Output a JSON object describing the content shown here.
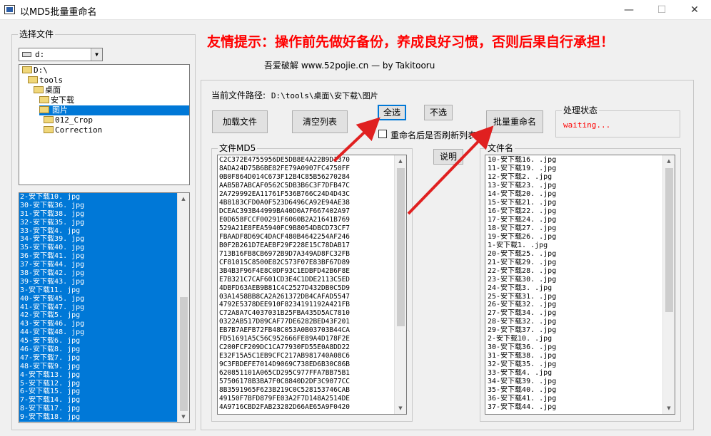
{
  "window": {
    "title": "以MD5批量重命名",
    "minimize": "—",
    "maximize": "☐",
    "close": "✕"
  },
  "left_panel": {
    "group_label": "选择文件",
    "drive": "d:",
    "tree": [
      {
        "label": "D:\\"
      },
      {
        "label": "tools"
      },
      {
        "label": "桌面"
      },
      {
        "label": "安下载"
      },
      {
        "label": "图片"
      },
      {
        "label": "012_Crop"
      },
      {
        "label": "Correction"
      }
    ],
    "files": [
      "2-安下载10. jpg",
      "30-安下载36. jpg",
      "31-安下载38. jpg",
      "32-安下载35. jpg",
      "33-安下载4. jpg",
      "34-安下载39. jpg",
      "35-安下载40. jpg",
      "36-安下载41. jpg",
      "37-安下载44. jpg",
      "38-安下载42. jpg",
      "39-安下载43. jpg",
      "3-安下载11. jpg",
      "40-安下载45. jpg",
      "41-安下载47. jpg",
      "42-安下载5. jpg",
      "43-安下载46. jpg",
      "44-安下载48. jpg",
      "45-安下载6. jpg",
      "46-安下载8. jpg",
      "47-安下载7. jpg",
      "48-安下载9. jpg",
      "4-安下载13. jpg",
      "5-安下载12. jpg",
      "6-安下载15. jpg",
      "7-安下载14. jpg",
      "8-安下载17. jpg",
      "9-安下载18. jpg"
    ]
  },
  "header": {
    "warning": "友情提示：操作前先做好备份，养成良好习惯，否则后果自行承担！",
    "credit": "吾爱破解    www.52pojie.cn  — by Takitooru"
  },
  "main": {
    "path_label": "当前文件路径:",
    "path_value": "D:\\tools\\桌面\\安下载\\图片",
    "buttons": {
      "load": "加载文件",
      "clear": "清空列表",
      "select_all": "全选",
      "deselect": "不选",
      "rename": "批量重命名",
      "explain": "说明"
    },
    "refresh_checkbox": "重命名后是否刷新列表",
    "status_label": "处理状态",
    "status_value": "waiting...",
    "md5_label": "文件MD5",
    "name_label": "文件名"
  },
  "md5_list": [
    "C2C372E4755956DE5DB8E4A22B9D1370",
    "8ADA24D75B6BE82FE79A0907FC4750FF",
    "0B0F864D014C673F12B4C85B56270284",
    "AAB5B7ABCAF0562C5DB3B6C3F7DFB47C",
    "2A729992EA11761F536B766C24D4D43C",
    "4B8183CFD0A0F523D6496CA92E94AE38",
    "DCEAC393B44999BA40D0A7F667402A97",
    "E0D658FCCF00291F6060B2A21641B769",
    "529A21E8FEA5940FC9B8054DBCD73CF7",
    "FBAADF8D69C4DACF480B4642254AF246",
    "B0F2B261D7EAEBF29F228E15C78DAB17",
    "713B16FB8CB6972B9D7A349AD8FC32FB",
    "CF81015C8500E82C573F07E83BF67D89",
    "3B4B3F96F4E8C0DF93C1EDBFD42B6F8E",
    "E7B321C7CAF601CD3E4C1DDE2113C5ED",
    "4DBFD63AEB9B81C4C2527D432DB0C5D9",
    "03A1458BB8CA2A261372DB4CAFAD5547",
    "4792E5378DEE910F8234191192A421FB",
    "C72A8A7C4037031B25FBA435D5AC7810",
    "0322AB517D89CAF77DE6282BED43F201",
    "EB7B7AEFB72FB48C053A0B03703B44CA",
    "FD51691A5C56C952666FE89A4D178F2E",
    "C200FCF209DC1CA77930FD55E0A8DD22",
    "E32F15A5C1EB9CFC217AB981740A08C6",
    "9C3FBDEFE7014D9069C738ED6B30C86B",
    "620851101A065CD295C977FFA7BB75B1",
    "57506178B3BA7F0C8840D2DF3C9077CC",
    "8B3591965F623B219C0C528153746CAB",
    "49150F7BFD879FE03A2F7D148A2514DE",
    "4A9716CBD2FAB23282D66AE65A9F0420"
  ],
  "name_list": [
    "10-安下载16. .jpg",
    "11-安下载19. .jpg",
    "12-安下载2. .jpg",
    "13-安下载23. .jpg",
    "14-安下载20. .jpg",
    "15-安下载21. .jpg",
    "16-安下载22. .jpg",
    "17-安下载24. .jpg",
    "18-安下载27. .jpg",
    "19-安下载26. .jpg",
    "1-安下载1. .jpg",
    "20-安下载25. .jpg",
    "21-安下载29. .jpg",
    "22-安下载28. .jpg",
    "23-安下载30. .jpg",
    "24-安下载3. .jpg",
    "25-安下载31. .jpg",
    "26-安下载32. .jpg",
    "27-安下载34. .jpg",
    "28-安下载32. .jpg",
    "29-安下载37. .jpg",
    "2-安下载10. .jpg",
    "30-安下载36. .jpg",
    "31-安下载38. .jpg",
    "32-安下载35. .jpg",
    "33-安下载4. .jpg",
    "34-安下载39. .jpg",
    "35-安下载40. .jpg",
    "36-安下载41. .jpg",
    "37-安下载44. .jpg"
  ]
}
